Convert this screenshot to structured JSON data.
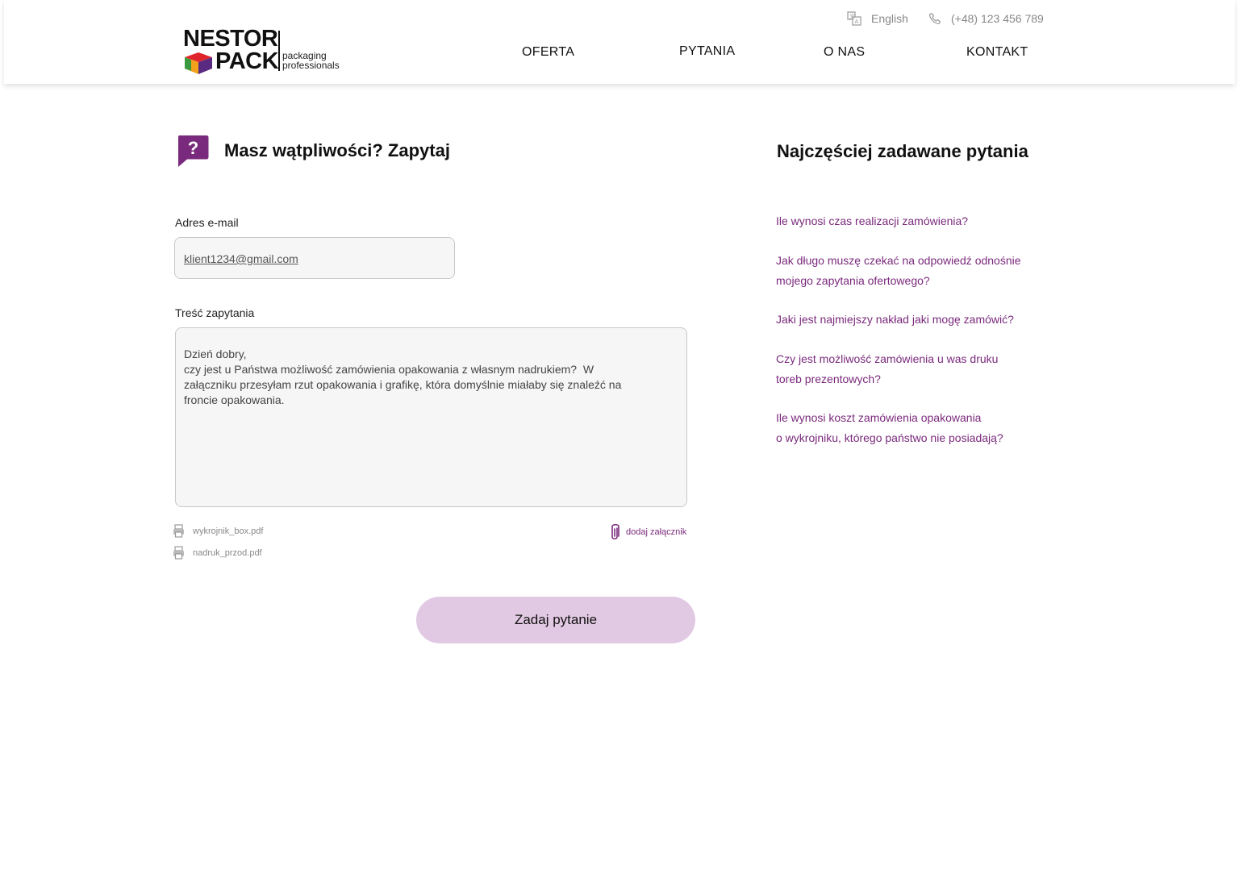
{
  "brand": {
    "logo_word_1": "NESTOR",
    "logo_word_2": "PACK",
    "tagline_1": "packaging",
    "tagline_2": "professionals",
    "accent_color": "#7a2a7c",
    "button_color": "#e2c9e3"
  },
  "topbar": {
    "language": "English",
    "language_icon": "translate-icon",
    "phone": "(+48) 123 456 789",
    "phone_icon": "phone-icon"
  },
  "nav": {
    "items": [
      {
        "label": "OFERTA"
      },
      {
        "label": "PYTANIA"
      },
      {
        "label": "O NAS"
      },
      {
        "label": "KONTAKT"
      }
    ]
  },
  "form": {
    "title": "Masz wątpliwości? Zapytaj",
    "title_icon": "question-bubble-icon",
    "email_label": "Adres e-mail",
    "email_value": "klient1234@gmail.com",
    "body_label": "Treść zapytania",
    "body_lines": [
      "Dzień dobry,",
      "czy jest u Państwa możliwość zamówienia opakowania z własnym nadrukiem?  W",
      "załączniku przesyłam rzut opakowania i grafikę, która domyślnie miałaby się znaleźć na",
      "froncie opakowania."
    ],
    "attachments": [
      {
        "name": "wykrojnik_box.pdf",
        "icon": "printer-icon"
      },
      {
        "name": "nadruk_przod.pdf",
        "icon": "printer-icon"
      }
    ],
    "add_attachment_label": "dodaj załącznik",
    "add_attachment_icon": "paperclip-icon",
    "submit_label": "Zadaj pytanie"
  },
  "faq": {
    "title": "Najczęściej zadawane pytania",
    "questions": [
      {
        "lines": [
          "Ile wynosi czas realizacji zamówienia?"
        ]
      },
      {
        "lines": [
          "Jak długo muszę czekać na odpowiedź odnośnie",
          "mojego zapytania ofertowego?"
        ]
      },
      {
        "lines": [
          "Jaki jest najmiejszy nakład jaki mogę zamówić?"
        ]
      },
      {
        "lines": [
          "Czy jest możliwość zamówienia u was druku",
          "toreb prezentowych?"
        ]
      },
      {
        "lines": [
          "Ile wynosi koszt zamówienia opakowania",
          "o wykrojniku, którego państwo nie posiadają?"
        ]
      }
    ]
  }
}
